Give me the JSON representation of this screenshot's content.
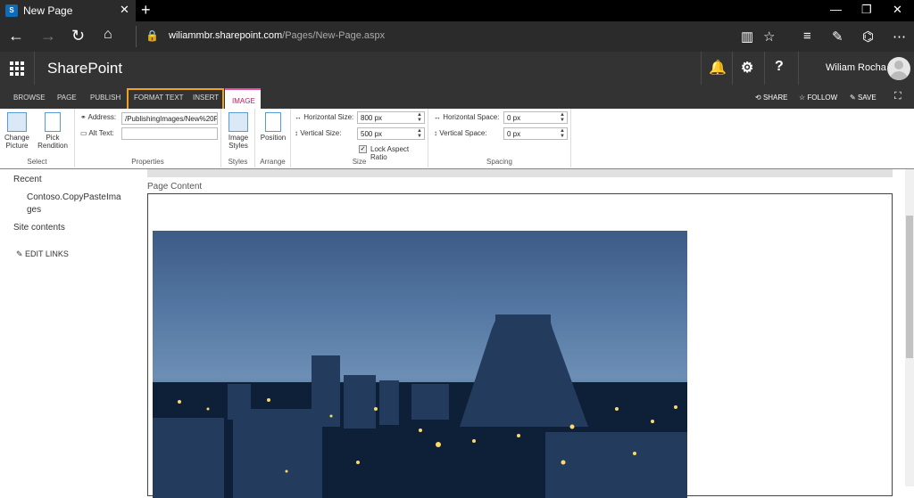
{
  "browser": {
    "tab_title": "New Page",
    "tab_icon": "S",
    "url_domain": "wiliammbr.sharepoint.com",
    "url_path": "/Pages/New-Page.aspx"
  },
  "suite_bar": {
    "brand": "SharePoint",
    "user_name": "Wiliam Rocha"
  },
  "ribbon_tabs": [
    "BROWSE",
    "PAGE",
    "PUBLISH",
    "FORMAT TEXT",
    "INSERT",
    "IMAGE"
  ],
  "ribbon_actions": {
    "share": "SHARE",
    "follow": "FOLLOW",
    "save": "SAVE"
  },
  "ribbon": {
    "select": {
      "label": "Select",
      "change_picture": "Change Picture",
      "pick_rendition": "Pick Rendition"
    },
    "properties": {
      "label": "Properties",
      "address_label": "Address:",
      "address_value": "/PublishingImages/New%20F",
      "alt_text_label": "Alt Text:",
      "alt_text_value": ""
    },
    "styles": {
      "label": "Styles",
      "image_styles": "Image Styles"
    },
    "arrange": {
      "label": "Arrange",
      "position": "Position"
    },
    "size": {
      "label": "Size",
      "horizontal_label": "Horizontal Size:",
      "horizontal_value": "800 px",
      "vertical_label": "Vertical Size:",
      "vertical_value": "500 px",
      "lock_label": "Lock Aspect Ratio",
      "lock_checked": true
    },
    "spacing": {
      "label": "Spacing",
      "horizontal_label": "Horizontal Space:",
      "horizontal_value": "0 px",
      "vertical_label": "Vertical Space:",
      "vertical_value": "0 px"
    }
  },
  "left_nav": {
    "recent": "Recent",
    "recent_item": "Contoso.CopyPasteIma\nges",
    "site_contents": "Site contents",
    "edit_links": "EDIT LINKS"
  },
  "content": {
    "page_content_label": "Page Content"
  }
}
